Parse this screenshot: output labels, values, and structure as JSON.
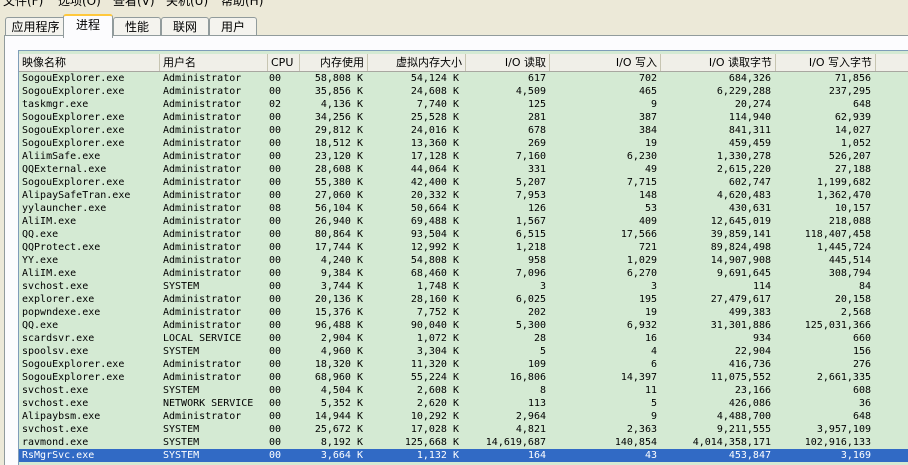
{
  "menu": [
    "文件(F)",
    "选项(O)",
    "查看(V)",
    "关机(U)",
    "帮助(H)"
  ],
  "tabs": [
    {
      "label": "应用程序",
      "active": false
    },
    {
      "label": "进程",
      "active": true
    },
    {
      "label": "性能",
      "active": false
    },
    {
      "label": "联网",
      "active": false
    },
    {
      "label": "用户",
      "active": false
    }
  ],
  "columns": [
    "映像名称",
    "用户名",
    "CPU",
    "内存使用",
    "虚拟内存大小",
    "I/O 读取",
    "I/O 写入",
    "I/O 读取字节",
    "I/O 写入字节"
  ],
  "selected_index": 29,
  "selection_color": "#316ac5",
  "list_background": "#d4ead3",
  "processes": [
    [
      "SogouExplorer.exe",
      "Administrator",
      "00",
      "58,808 K",
      "54,124 K",
      "617",
      "702",
      "684,326",
      "71,856"
    ],
    [
      "SogouExplorer.exe",
      "Administrator",
      "00",
      "35,856 K",
      "24,608 K",
      "4,509",
      "465",
      "6,229,288",
      "237,295"
    ],
    [
      "taskmgr.exe",
      "Administrator",
      "02",
      "4,136 K",
      "7,740 K",
      "125",
      "9",
      "20,274",
      "648"
    ],
    [
      "SogouExplorer.exe",
      "Administrator",
      "00",
      "34,256 K",
      "25,528 K",
      "281",
      "387",
      "114,940",
      "62,939"
    ],
    [
      "SogouExplorer.exe",
      "Administrator",
      "00",
      "29,812 K",
      "24,016 K",
      "678",
      "384",
      "841,311",
      "14,027"
    ],
    [
      "SogouExplorer.exe",
      "Administrator",
      "00",
      "18,512 K",
      "13,360 K",
      "269",
      "19",
      "459,459",
      "1,052"
    ],
    [
      "AliimSafe.exe",
      "Administrator",
      "00",
      "23,120 K",
      "17,128 K",
      "7,160",
      "6,230",
      "1,330,278",
      "526,207"
    ],
    [
      "QQExternal.exe",
      "Administrator",
      "00",
      "28,608 K",
      "44,064 K",
      "331",
      "49",
      "2,615,220",
      "27,188"
    ],
    [
      "SogouExplorer.exe",
      "Administrator",
      "00",
      "55,380 K",
      "42,400 K",
      "5,207",
      "7,715",
      "602,747",
      "1,199,682"
    ],
    [
      "AlipaySafeTran.exe",
      "Administrator",
      "00",
      "27,060 K",
      "20,332 K",
      "7,953",
      "148",
      "4,620,483",
      "1,362,470"
    ],
    [
      "yylauncher.exe",
      "Administrator",
      "08",
      "56,104 K",
      "50,664 K",
      "126",
      "53",
      "430,631",
      "10,157"
    ],
    [
      "AliIM.exe",
      "Administrator",
      "00",
      "26,940 K",
      "69,488 K",
      "1,567",
      "409",
      "12,645,019",
      "218,088"
    ],
    [
      "QQ.exe",
      "Administrator",
      "00",
      "80,864 K",
      "93,504 K",
      "6,515",
      "17,566",
      "39,859,141",
      "118,407,458"
    ],
    [
      "QQProtect.exe",
      "Administrator",
      "00",
      "17,744 K",
      "12,992 K",
      "1,218",
      "721",
      "89,824,498",
      "1,445,724"
    ],
    [
      "YY.exe",
      "Administrator",
      "00",
      "4,240 K",
      "54,808 K",
      "958",
      "1,029",
      "14,907,908",
      "445,514"
    ],
    [
      "AliIM.exe",
      "Administrator",
      "00",
      "9,384 K",
      "68,460 K",
      "7,096",
      "6,270",
      "9,691,645",
      "308,794"
    ],
    [
      "svchost.exe",
      "SYSTEM",
      "00",
      "3,744 K",
      "1,748 K",
      "3",
      "3",
      "114",
      "84"
    ],
    [
      "explorer.exe",
      "Administrator",
      "00",
      "20,136 K",
      "28,160 K",
      "6,025",
      "195",
      "27,479,617",
      "20,158"
    ],
    [
      "popwndexe.exe",
      "Administrator",
      "00",
      "15,376 K",
      "7,752 K",
      "202",
      "19",
      "499,383",
      "2,568"
    ],
    [
      "QQ.exe",
      "Administrator",
      "00",
      "96,488 K",
      "90,040 K",
      "5,300",
      "6,932",
      "31,301,886",
      "125,031,366"
    ],
    [
      "scardsvr.exe",
      "LOCAL SERVICE",
      "00",
      "2,904 K",
      "1,072 K",
      "28",
      "16",
      "934",
      "660"
    ],
    [
      "spoolsv.exe",
      "SYSTEM",
      "00",
      "4,960 K",
      "3,304 K",
      "5",
      "4",
      "22,904",
      "156"
    ],
    [
      "SogouExplorer.exe",
      "Administrator",
      "00",
      "18,320 K",
      "11,320 K",
      "109",
      "6",
      "416,736",
      "276"
    ],
    [
      "SogouExplorer.exe",
      "Administrator",
      "00",
      "68,960 K",
      "55,224 K",
      "16,806",
      "14,397",
      "11,075,552",
      "2,661,335"
    ],
    [
      "svchost.exe",
      "SYSTEM",
      "00",
      "4,504 K",
      "2,608 K",
      "8",
      "11",
      "23,166",
      "608"
    ],
    [
      "svchost.exe",
      "NETWORK SERVICE",
      "00",
      "5,352 K",
      "2,620 K",
      "113",
      "5",
      "426,086",
      "36"
    ],
    [
      "Alipaybsm.exe",
      "Administrator",
      "00",
      "14,944 K",
      "10,292 K",
      "2,964",
      "9",
      "4,488,700",
      "648"
    ],
    [
      "svchost.exe",
      "SYSTEM",
      "00",
      "25,672 K",
      "17,028 K",
      "4,821",
      "2,363",
      "9,211,555",
      "3,957,109"
    ],
    [
      "ravmond.exe",
      "SYSTEM",
      "00",
      "8,192 K",
      "125,668 K",
      "14,619,687",
      "140,854",
      "4,014,358,171",
      "102,916,133"
    ],
    [
      "RsMgrSvc.exe",
      "SYSTEM",
      "00",
      "3,664 K",
      "1,132 K",
      "164",
      "43",
      "453,847",
      "3,169"
    ]
  ]
}
